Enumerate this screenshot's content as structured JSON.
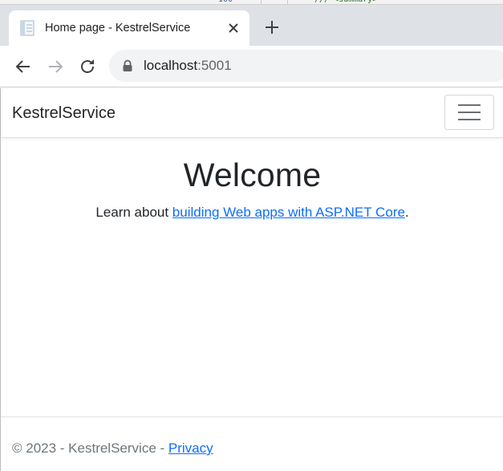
{
  "browser": {
    "tab": {
      "title": "Home page - KestrelService",
      "close_icon": "close-icon",
      "favicon_icon": "page-favicon-icon"
    },
    "new_tab_icon": "plus-icon",
    "toolbar": {
      "back_icon": "arrow-left-icon",
      "forward_icon": "arrow-right-icon",
      "reload_icon": "reload-icon",
      "lock_icon": "lock-icon"
    },
    "address": {
      "host": "localhost",
      "port": ":5001"
    }
  },
  "page": {
    "navbar": {
      "brand": "KestrelService",
      "toggler_icon": "hamburger-icon"
    },
    "main": {
      "heading": "Welcome",
      "lead_prefix": "Learn about ",
      "lead_link": "building Web apps with ASP.NET Core",
      "lead_suffix": "."
    },
    "footer": {
      "copyright": "© 2023 - KestrelService - ",
      "privacy_link": "Privacy"
    }
  },
  "colors": {
    "chrome_bg": "#dee1e6",
    "omnibox_bg": "#f1f3f4",
    "link": "#0d6efd",
    "text": "#212529",
    "muted": "#6c757d"
  }
}
